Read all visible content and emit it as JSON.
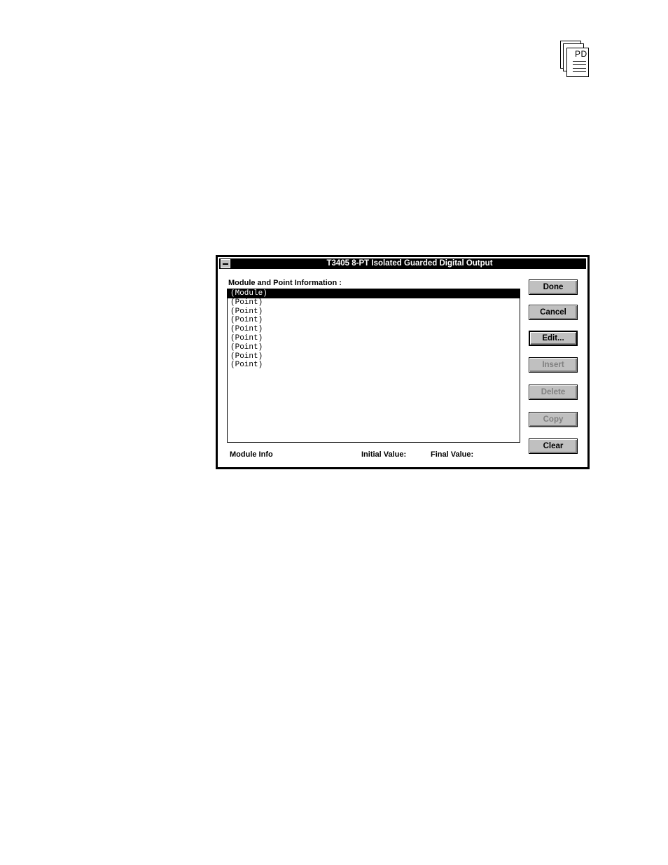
{
  "corner_icon": {
    "text": "PD"
  },
  "dialog": {
    "title": "T3405  8-PT  Isolated Guarded Digital Output",
    "list_label": "Module and Point Information :",
    "list_items": [
      "(Module)",
      "(Point)",
      "(Point)",
      "(Point)",
      "(Point)",
      "(Point)",
      "(Point)",
      "(Point)",
      "(Point)"
    ],
    "selected_index": 0,
    "buttons": {
      "done": "Done",
      "cancel": "Cancel",
      "edit": "Edit...",
      "insert": "Insert",
      "delete": "Delete",
      "copy": "Copy",
      "clear": "Clear"
    },
    "footer": {
      "module_info": "Module Info",
      "initial_value": "Initial Value:",
      "final_value": "Final Value:"
    }
  }
}
